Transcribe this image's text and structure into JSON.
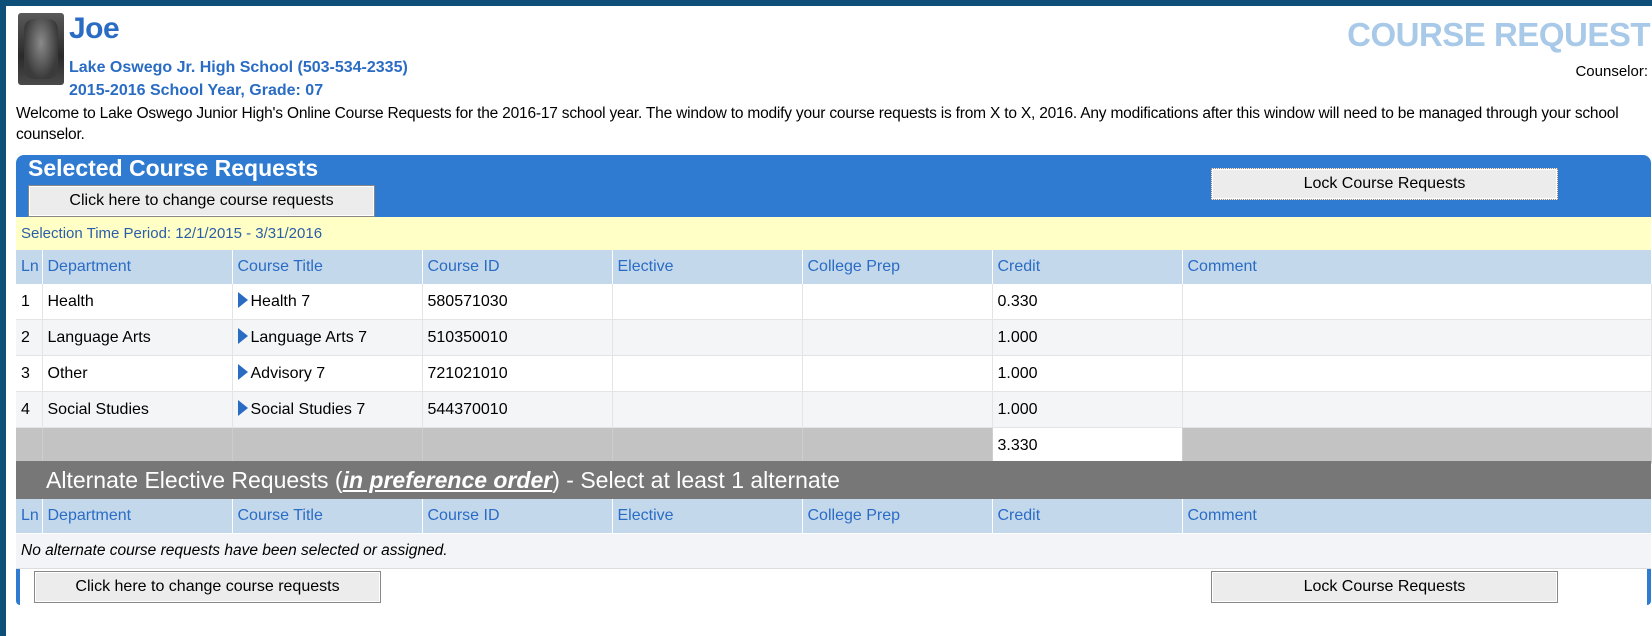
{
  "student": {
    "name": "Joe",
    "school": "Lake Oswego Jr. High School (503-534-2335)",
    "year_grade": "2015-2016 School Year, Grade: 07"
  },
  "page_heading": "COURSE REQUEST",
  "counselor_label": "Counselor:",
  "welcome_text": "Welcome to Lake Oswego Junior High's Online Course Requests for the 2016-17 school year. The window to modify your course requests is from X to X, 2016. Any modifications after this window will need to be managed through your school counselor.",
  "selected": {
    "title": "Selected Course Requests",
    "change_button": "Click here to change course requests",
    "lock_button": "Lock Course Requests",
    "period": "Selection Time Period: 12/1/2015 - 3/31/2016",
    "columns": [
      "Ln",
      "Department",
      "Course Title",
      "Course ID",
      "Elective",
      "College Prep",
      "Credit",
      "Comment"
    ],
    "rows": [
      {
        "ln": "1",
        "department": "Health",
        "title": "Health 7",
        "course_id": "580571030",
        "elective": "",
        "college_prep": "",
        "credit": "0.330",
        "comment": ""
      },
      {
        "ln": "2",
        "department": "Language Arts",
        "title": "Language Arts 7",
        "course_id": "510350010",
        "elective": "",
        "college_prep": "",
        "credit": "1.000",
        "comment": ""
      },
      {
        "ln": "3",
        "department": "Other",
        "title": "Advisory 7",
        "course_id": "721021010",
        "elective": "",
        "college_prep": "",
        "credit": "1.000",
        "comment": ""
      },
      {
        "ln": "4",
        "department": "Social Studies",
        "title": "Social Studies 7",
        "course_id": "544370010",
        "elective": "",
        "college_prep": "",
        "credit": "1.000",
        "comment": ""
      }
    ],
    "total_credit": "3.330"
  },
  "alternate": {
    "title_prefix": "Alternate Elective Requests (",
    "title_emphasis": "in preference order",
    "title_suffix": ") - Select at least 1 alternate",
    "columns": [
      "Ln",
      "Department",
      "Course Title",
      "Course ID",
      "Elective",
      "College Prep",
      "Credit",
      "Comment"
    ],
    "empty_message": "No alternate course requests have been selected or assigned.",
    "change_button": "Click here to change course requests",
    "lock_button": "Lock Course Requests"
  },
  "colors": {
    "header_blue": "#2e7bd1",
    "link_blue": "#2a6cc4",
    "heading_light_blue": "#a9c9e8",
    "period_yellow": "#ffffc6",
    "alt_bar_gray": "#777777"
  }
}
